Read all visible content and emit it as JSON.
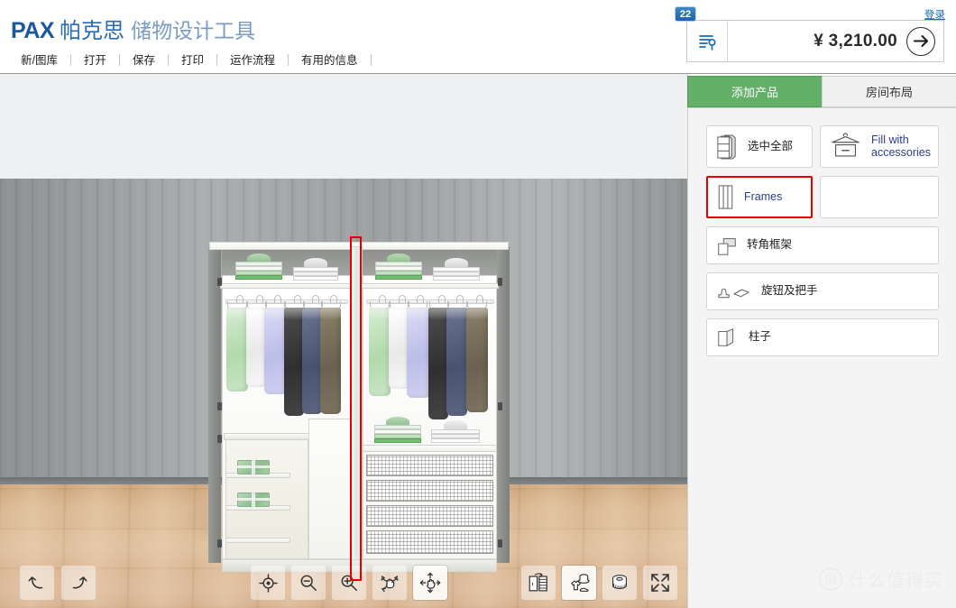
{
  "header": {
    "brand_logo": "PAX",
    "brand_name_cn": "帕克思",
    "brand_subtitle_cn": "储物设计工具",
    "login_label": "登录",
    "menu": [
      {
        "label": "新/图库",
        "name": "menu-item-new-gallery"
      },
      {
        "label": "打开",
        "name": "menu-item-open"
      },
      {
        "label": "保存",
        "name": "menu-item-save"
      },
      {
        "label": "打印",
        "name": "menu-item-print"
      },
      {
        "label": "运作流程",
        "name": "menu-item-workflow"
      },
      {
        "label": "有用的信息",
        "name": "menu-item-useful-info"
      }
    ],
    "cart": {
      "badge_count": "22",
      "price": "¥ 3,210.00",
      "list_icon": "list-search-icon",
      "go_icon": "arrow-right-icon"
    }
  },
  "panel": {
    "tabs": [
      {
        "label": "添加产品",
        "active": true
      },
      {
        "label": "房间布局",
        "active": false
      }
    ],
    "buttons": [
      {
        "label": "选中全部",
        "icon": "stacked-frames-icon",
        "selected": false
      },
      {
        "label": "Fill with accessories",
        "icon": "hanger-drawer-icon",
        "selected": false
      },
      {
        "label": "Frames",
        "icon": "frame-icon",
        "selected": true
      },
      {
        "label": "转角框架",
        "icon": "corner-frame-icon",
        "selected": false
      },
      {
        "label": "旋钮及把手",
        "icon": "knob-handle-icon",
        "selected": false
      },
      {
        "label": "柱子",
        "icon": "pillar-icon",
        "selected": false
      }
    ]
  },
  "toolbar": {
    "left": [
      {
        "name": "undo-button",
        "icon": "undo-arrow-icon"
      },
      {
        "name": "redo-button",
        "icon": "redo-arrow-icon"
      }
    ],
    "center": [
      {
        "name": "recenter-button",
        "icon": "crosshair-target-icon"
      },
      {
        "name": "zoom-out-button",
        "icon": "magnifier-minus-icon"
      },
      {
        "name": "zoom-in-button",
        "icon": "magnifier-plus-icon"
      },
      {
        "name": "rotate-view-button",
        "icon": "hand-rotate-icon"
      },
      {
        "name": "pan-view-button",
        "icon": "hand-pan-icon"
      }
    ],
    "right": [
      {
        "name": "toggle-doors-button",
        "icon": "wardrobe-doors-icon",
        "active": false
      },
      {
        "name": "toggle-accessories-button",
        "icon": "clothes-hat-icon",
        "active": true
      },
      {
        "name": "measure-button",
        "icon": "measuring-tape-icon",
        "active": false
      },
      {
        "name": "fullscreen-button",
        "icon": "expand-arrows-icon",
        "active": false
      }
    ]
  },
  "viewport": {
    "scene_name": "pax-wardrobe-3d-scene",
    "selection": "frame-divider-selected",
    "wall_color": "#9c9fa0",
    "floor_color": "#d6b292",
    "ceiling_color": "#eef0f2",
    "selection_color": "#e60000",
    "garments_left": [
      "green",
      "white",
      "lavender",
      "dark-gray",
      "navy",
      "brown"
    ],
    "garments_right": [
      "green",
      "white",
      "lavender",
      "dark-gray",
      "navy",
      "brown"
    ]
  },
  "watermark": {
    "logo": "值",
    "text": "什么值得买"
  },
  "colors": {
    "accent_green": "#63b069",
    "brand_blue": "#1a57a0",
    "selection_red": "#e60000",
    "badge_blue": "#1f63ab"
  }
}
